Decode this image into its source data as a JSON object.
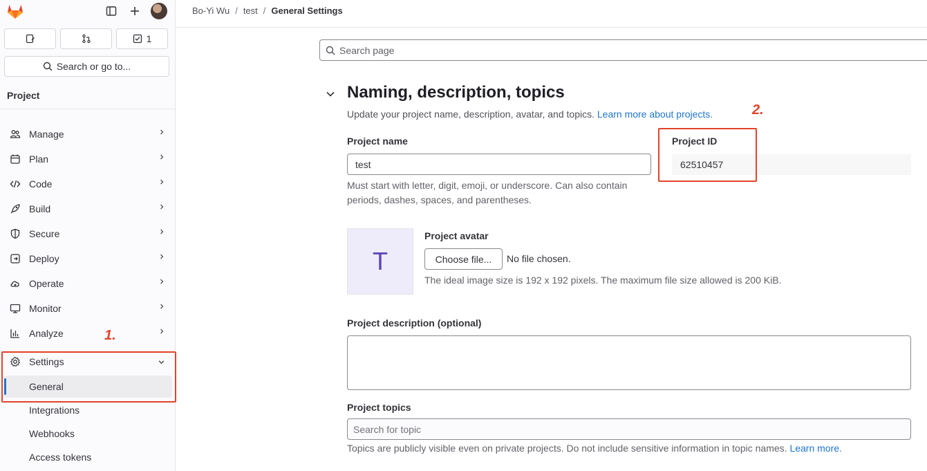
{
  "colors": {
    "accent": "#1f75cb",
    "annotation": "#e2432a",
    "avatar_bg": "#eeebfa",
    "avatar_letter": "#5943b6"
  },
  "topbar": {
    "logo_icon": "gitlab-tanuki-icon",
    "sidebar_toggle_icon": "sidebar-toggle-icon",
    "new_icon": "plus-icon",
    "avatar_icon": "user-avatar"
  },
  "counters": [
    {
      "icon": "issues-icon",
      "count": ""
    },
    {
      "icon": "merge-request-icon",
      "count": ""
    },
    {
      "icon": "todo-icon",
      "count": "1"
    }
  ],
  "search": {
    "label": "Search or go to..."
  },
  "sidebar": {
    "section_title": "Project",
    "items": [
      {
        "label": "Manage",
        "icon": "users-icon"
      },
      {
        "label": "Plan",
        "icon": "calendar-icon"
      },
      {
        "label": "Code",
        "icon": "code-icon"
      },
      {
        "label": "Build",
        "icon": "rocket-icon"
      },
      {
        "label": "Secure",
        "icon": "shield-icon"
      },
      {
        "label": "Deploy",
        "icon": "deploy-icon"
      },
      {
        "label": "Operate",
        "icon": "cloud-icon"
      },
      {
        "label": "Monitor",
        "icon": "monitor-icon"
      },
      {
        "label": "Analyze",
        "icon": "chart-icon"
      }
    ],
    "settings": {
      "label": "Settings",
      "sub": [
        "General",
        "Integrations",
        "Webhooks",
        "Access tokens"
      ]
    }
  },
  "annotations": {
    "first": "1.",
    "second": "2."
  },
  "breadcrumb": {
    "user": "Bo-Yi Wu",
    "project": "test",
    "current": "General Settings",
    "sep": "/"
  },
  "page_search": {
    "placeholder": "Search page"
  },
  "section": {
    "title": "Naming, description, topics",
    "description": "Update your project name, description, avatar, and topics.",
    "description_link": "Learn more about projects."
  },
  "form": {
    "name_label": "Project name",
    "name_value": "test",
    "name_help_1": "Must start with letter, digit, emoji, or underscore. Can also contain",
    "name_help_2": "periods, dashes, spaces, and parentheses.",
    "id_label": "Project ID",
    "id_value": "62510457",
    "avatar_letter": "T",
    "avatar_label": "Project avatar",
    "choose_file": "Choose file...",
    "no_file": "No file chosen.",
    "avatar_help": "The ideal image size is 192 x 192 pixels. The maximum file size allowed is 200 KiB.",
    "description_label": "Project description (optional)",
    "topics_label": "Project topics",
    "topics_placeholder": "Search for topic",
    "topics_help": "Topics are publicly visible even on private projects. Do not include sensitive information in topic names.",
    "topics_link": "Learn more."
  }
}
